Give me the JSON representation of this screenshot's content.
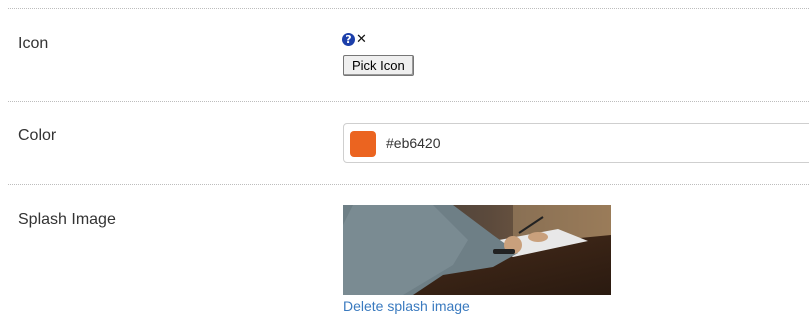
{
  "rows": {
    "icon": {
      "label": "Icon",
      "help_glyph": "?",
      "clear_glyph": "✕",
      "pick_button": "Pick Icon",
      "icons": [
        "help-icon",
        "clear-icon"
      ]
    },
    "color": {
      "label": "Color",
      "value": "#eb6420",
      "swatch_color": "#eb6420"
    },
    "splash": {
      "label": "Splash Image",
      "delete_link": "Delete splash image"
    }
  }
}
